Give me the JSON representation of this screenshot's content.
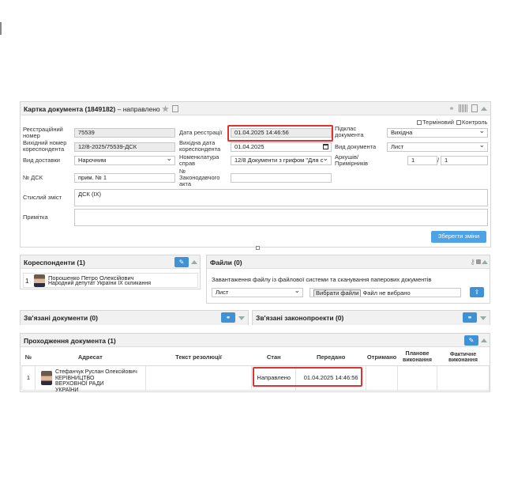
{
  "card": {
    "title": "Картка документа",
    "number": "(1849182)",
    "dash": "–",
    "status": "направлено"
  },
  "checkboxes": {
    "term": "Термiновий",
    "control": "Контроль"
  },
  "form": {
    "reg_number_label": "Реєстраційний номер",
    "reg_number": "75539",
    "reg_date_label": "Дата реєстрації",
    "reg_date": "01.04.2025 14:46:56",
    "signer_label": "Підклас документа",
    "signer_value": "Вихідна",
    "out_number_label": "Вихідний номер кореспондента",
    "out_number": "12/8-2025/75539-ДСК",
    "out_date_label": "Вихідна дата кореспондента",
    "out_date": "01.04.2025",
    "doc_type_label": "Вид документа",
    "doc_type": "Лист",
    "delivery_label": "Вид доставки",
    "delivery": "Нарочним",
    "nomenclature_label": "Номенклатура справ",
    "nomenclature": "12/8 Документи з грифом \"Для с",
    "sheets_label": "Аркушів/ Примірників",
    "sheets": "1",
    "copies": "1",
    "sheets_sep": "/",
    "dsk_label": "№ ДСК",
    "dsk": "прим. № 1",
    "law_label": "№ Законодавчого акта",
    "law": "",
    "summary_label": "Стислий зміст",
    "summary": "ДСК (IX)",
    "note_label": "Примітка",
    "note": "",
    "save_button": "Зберегти зміни"
  },
  "correspondents": {
    "title": "Кореспонденти (1)",
    "rows": [
      {
        "num": "1",
        "name": "Порошенко Петро Олексійович",
        "position": "Народний депутат України IX скликання"
      }
    ]
  },
  "files": {
    "title": "Файли (0)",
    "upload_caption": "Завантаження файлу із файлової системи та сканування паперових документів",
    "type_select": "Лист",
    "choose_button": "Вибрати файли",
    "no_file": "Файл не вибрано"
  },
  "linked_docs": {
    "title": "Зв'язані документи (0)"
  },
  "linked_bills": {
    "title": "Зв'язані законопроекти (0)"
  },
  "route": {
    "title": "Проходження документа (1)",
    "columns": [
      "№",
      "Адресат",
      "Текст резолюції",
      "Стан",
      "Передано",
      "Отримано",
      "Планове виконання",
      "Фактичне виконання"
    ],
    "rows": [
      {
        "num": "1",
        "addressee_name": "Стефанчук Руслан Олексійович",
        "addressee_org": "КЕРІВНИЦТВО ВЕРХОВНОЇ РАДИ УКРАЇНИ",
        "resolution": "",
        "state": "Направлено",
        "sent": "01.04.2025 14:46:56",
        "received": "",
        "planned": "",
        "actual": ""
      }
    ]
  },
  "colors": {
    "accent": "#3f92d6",
    "highlight": "#e0322f"
  }
}
